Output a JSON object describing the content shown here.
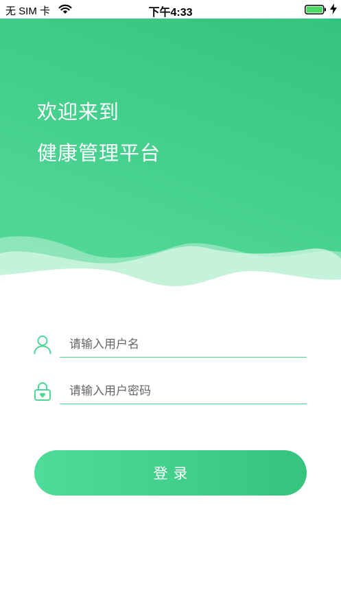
{
  "status_bar": {
    "carrier": "无 SIM 卡",
    "time": "下午4:33",
    "wifi_icon": "wifi-icon",
    "battery_icon": "battery-icon",
    "charging_icon": "charging-bolt-icon"
  },
  "hero": {
    "welcome_line1": "欢迎来到",
    "welcome_line2": "健康管理平台"
  },
  "form": {
    "username": {
      "value": "",
      "placeholder": "请输入用户名",
      "icon": "user-icon"
    },
    "password": {
      "value": "",
      "placeholder": "请输入用户密码",
      "icon": "lock-icon"
    },
    "login_label": "登录"
  },
  "colors": {
    "accent": "#4ed694",
    "accent_dark": "#34c37f",
    "text": "#333333"
  }
}
